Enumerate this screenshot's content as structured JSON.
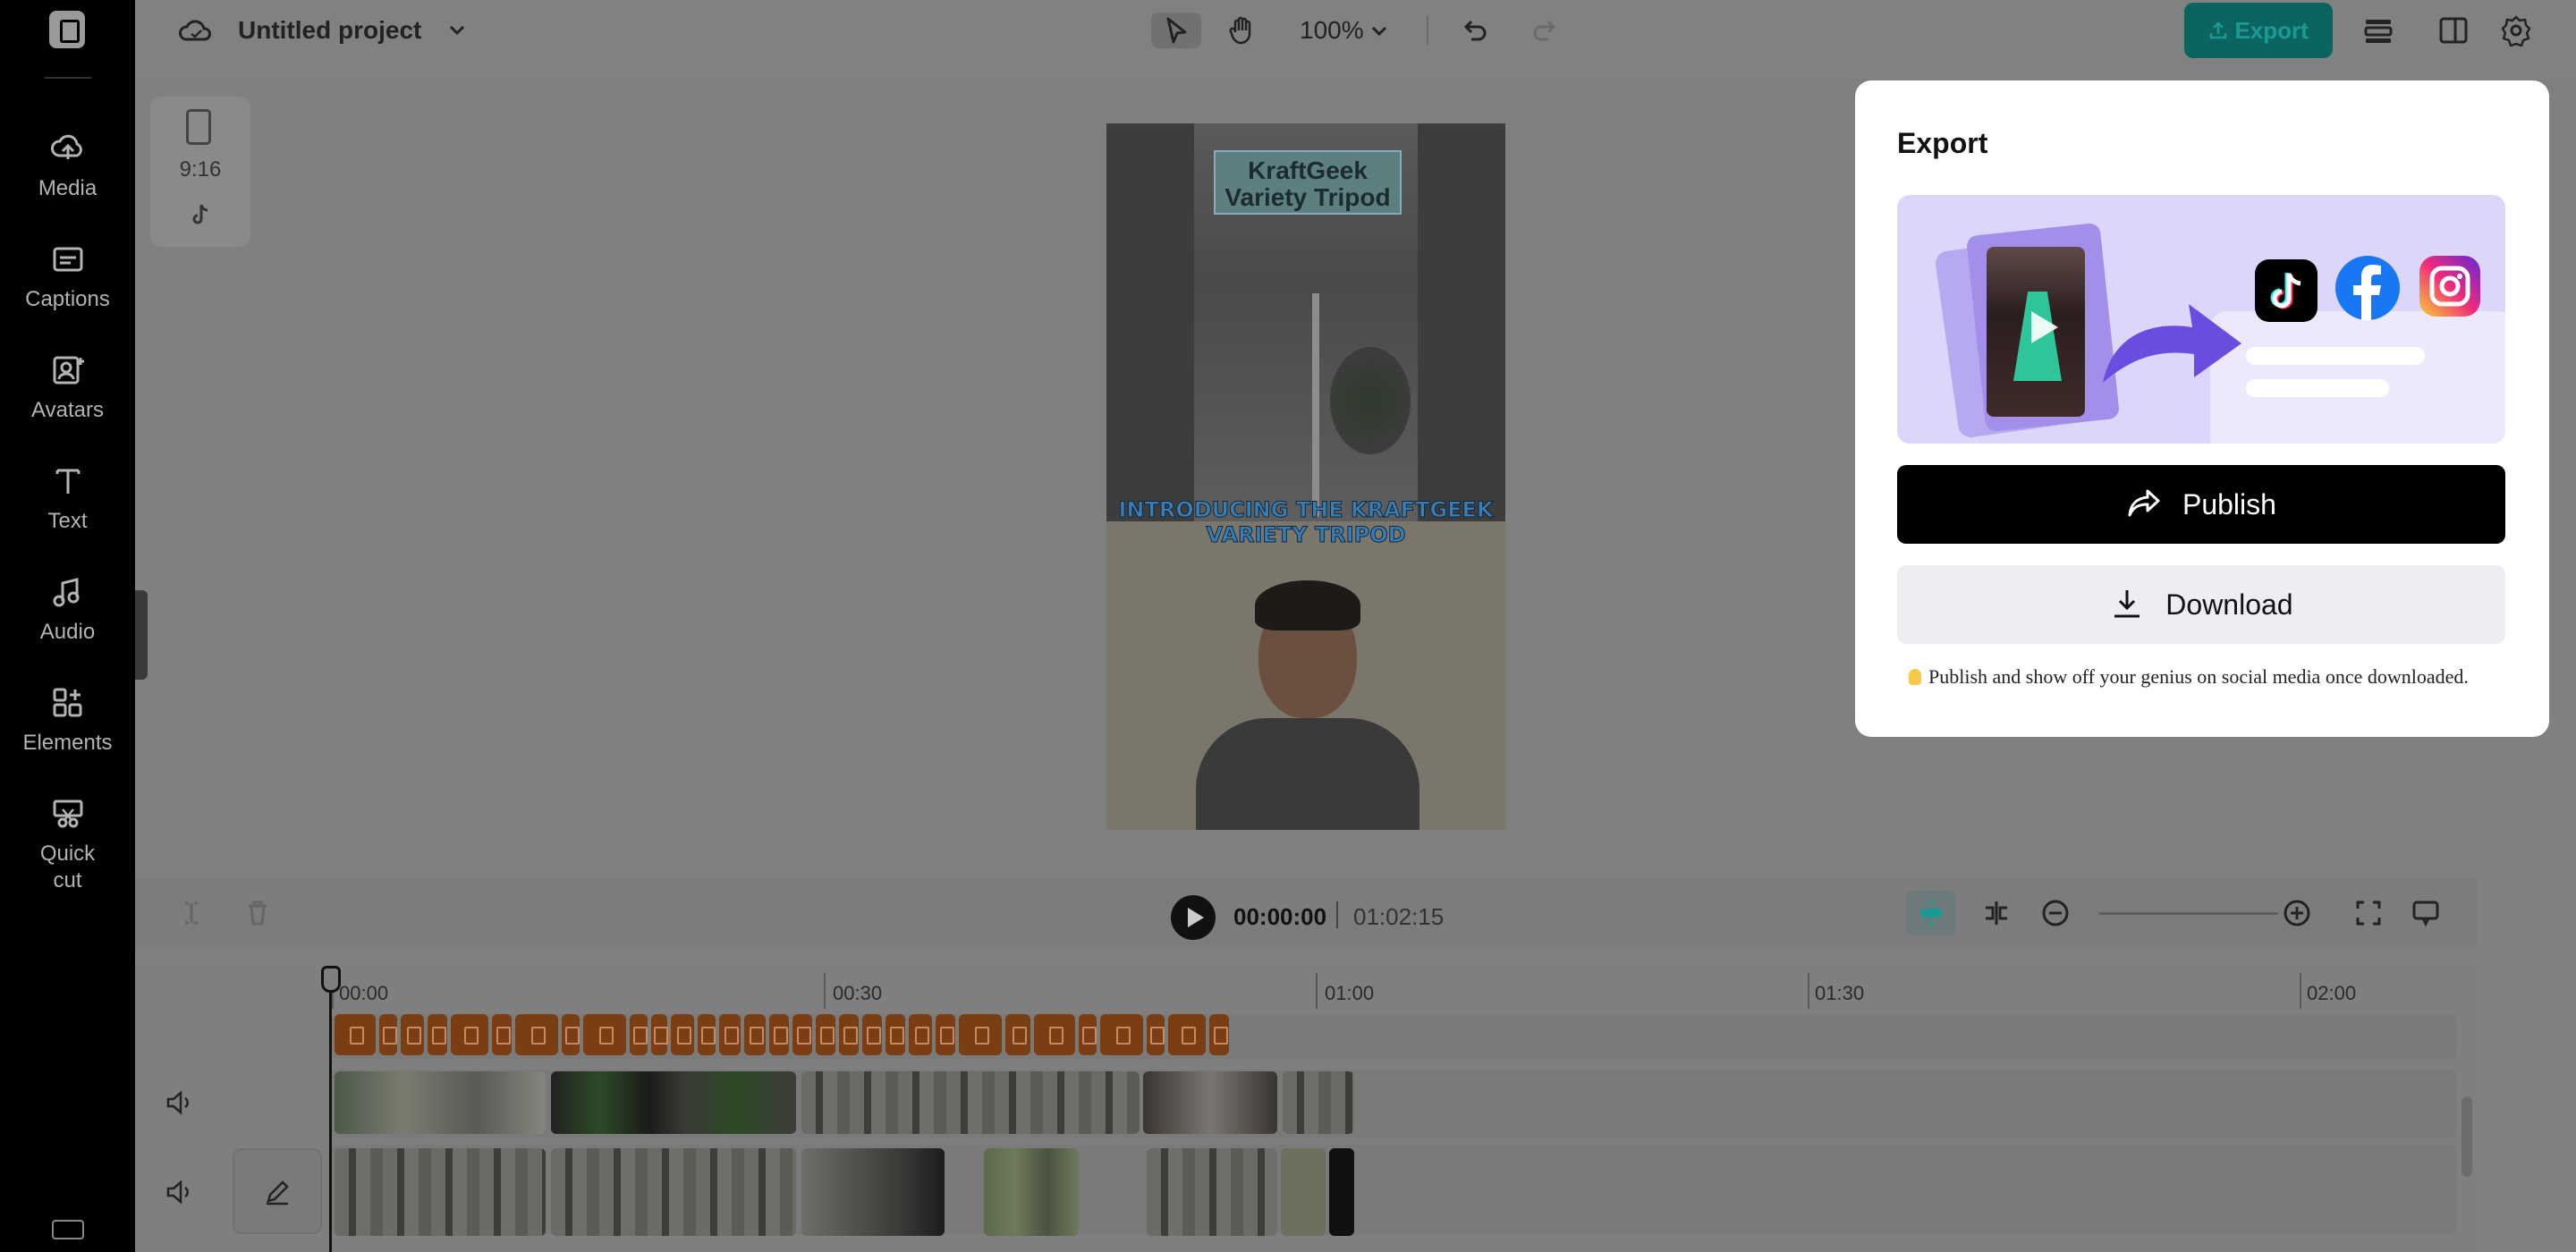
{
  "sidebar": {
    "items": [
      {
        "label": "Media",
        "icon": "cloud-upload-icon"
      },
      {
        "label": "Captions",
        "icon": "captions-icon"
      },
      {
        "label": "Avatars",
        "icon": "avatar-icon"
      },
      {
        "label": "Text",
        "icon": "text-icon"
      },
      {
        "label": "Audio",
        "icon": "music-note-icon"
      },
      {
        "label": "Elements",
        "icon": "elements-icon"
      },
      {
        "label": "Quick cut",
        "icon": "quick-cut-icon"
      }
    ]
  },
  "topbar": {
    "project_title": "Untitled project",
    "zoom": "100%",
    "export_label": "Export"
  },
  "canvas": {
    "ratio": "9:16",
    "preview_title": "KraftGeek Variety Tripod",
    "preview_caption": "INTRODUCING THE KRAFTGEEK VARIETY TRIPOD"
  },
  "transport": {
    "current_time": "00:00:00",
    "total_time": "01:02:15"
  },
  "timeline": {
    "ruler": [
      "00:00",
      "00:30",
      "01:00",
      "01:30",
      "02:00"
    ]
  },
  "export_panel": {
    "title": "Export",
    "publish_label": "Publish",
    "download_label": "Download",
    "tip": "Publish and show off your genius on social media once downloaded."
  },
  "colors": {
    "export_teal": "#0c6461",
    "banner_lavender": "#dcd6fb",
    "caption_track": "#7a3e15"
  }
}
